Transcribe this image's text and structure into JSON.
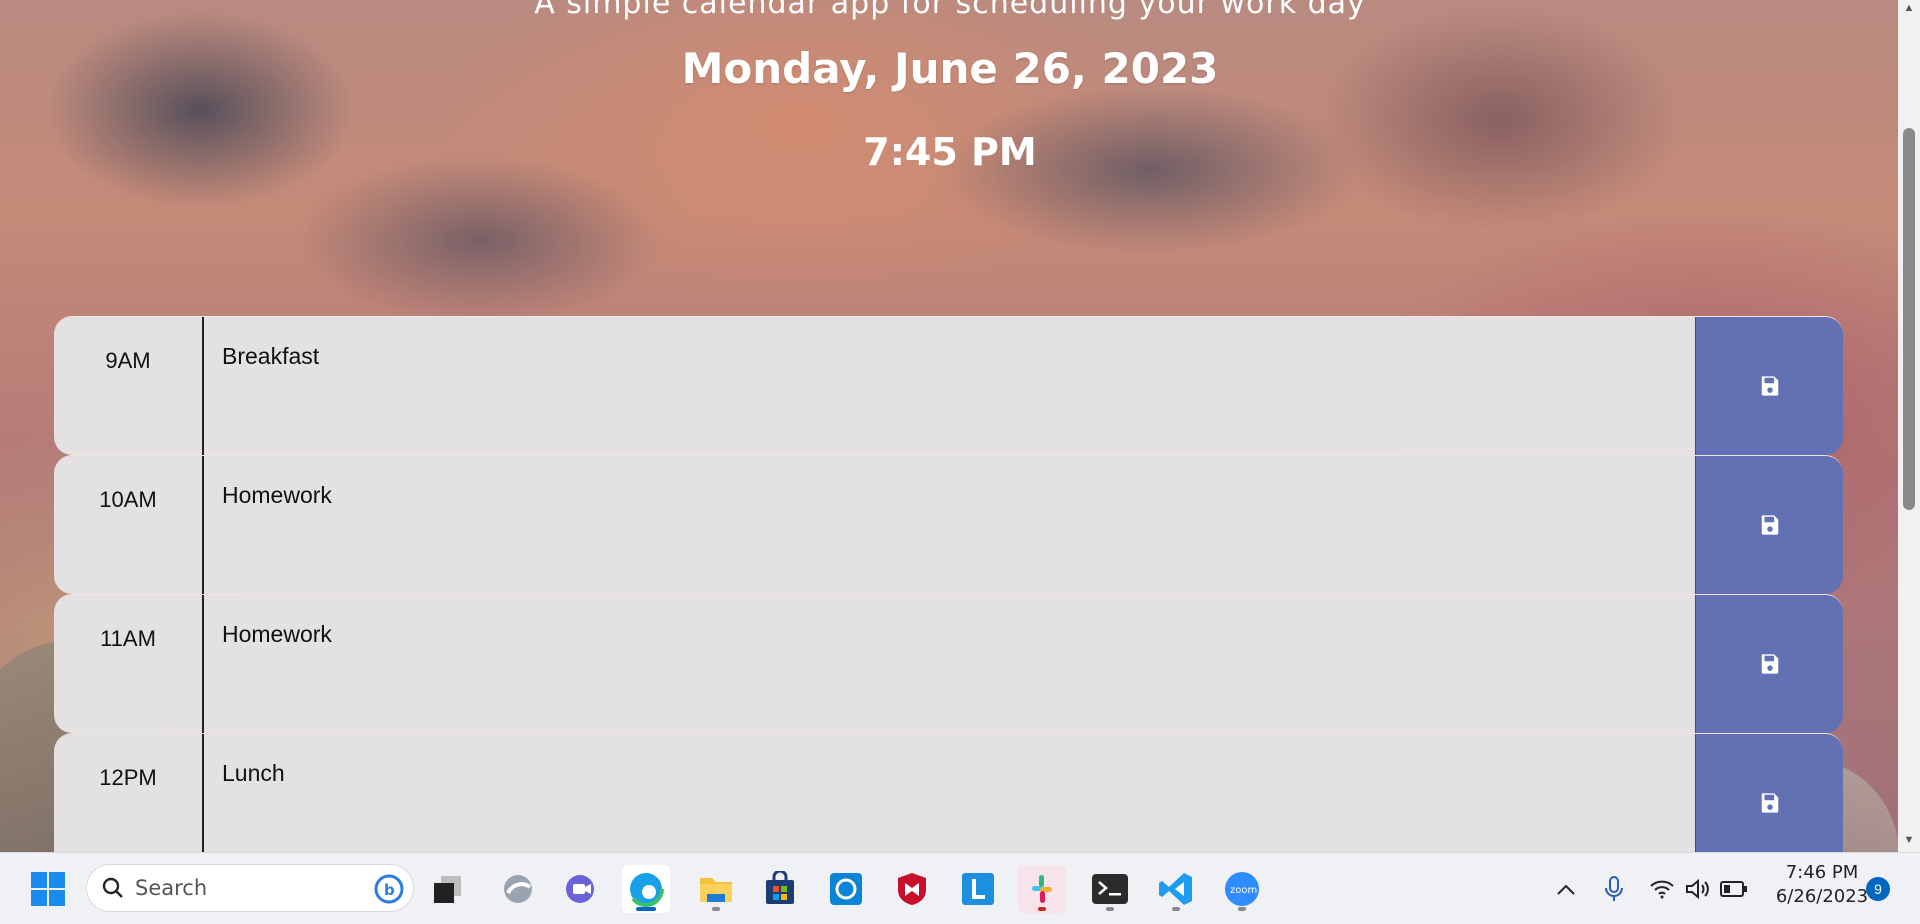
{
  "page": {
    "lead_text_cut": "A simple calendar app for scheduling your work day",
    "date": "Monday, June 26, 2023",
    "time": "7:45 PM"
  },
  "planner": {
    "rows": [
      {
        "hour": "9AM",
        "description": "Breakfast"
      },
      {
        "hour": "10AM",
        "description": "Homework"
      },
      {
        "hour": "11AM",
        "description": "Homework"
      },
      {
        "hour": "12PM",
        "description": "Lunch"
      }
    ],
    "save_icon": "save-icon"
  },
  "taskbar": {
    "search_placeholder": "Search",
    "apps": [
      "start-icon",
      "search-icon",
      "bing-chat-icon",
      "task-view-icon",
      "widgets-icon",
      "teams-chat-icon",
      "edge-icon",
      "file-explorer-icon",
      "store-icon",
      "cortana-icon",
      "mcafee-icon",
      "l-app-icon",
      "slack-icon",
      "terminal-icon",
      "vscode-icon",
      "zoom-icon"
    ],
    "clock_time": "7:46 PM",
    "clock_date": "6/26/2023",
    "notification_count": "9"
  },
  "colors": {
    "save_button": "#6271b4",
    "row_background": "#e3e1e2",
    "accent": "#0067c0"
  }
}
